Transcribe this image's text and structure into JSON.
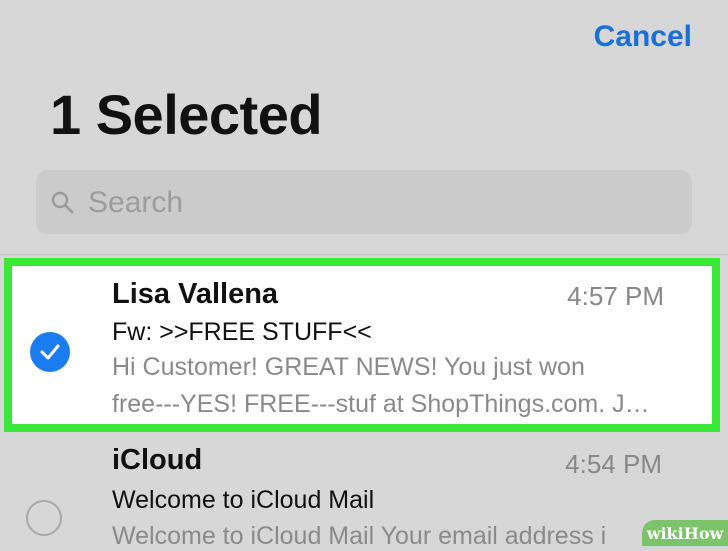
{
  "header": {
    "cancel_label": "Cancel",
    "title": "1 Selected"
  },
  "search": {
    "placeholder": "Search"
  },
  "messages": [
    {
      "sender": "Lisa Vallena",
      "time": "4:57 PM",
      "subject": "Fw: >>FREE STUFF<<",
      "preview_line1": "Hi Customer! GREAT NEWS! You just won",
      "preview_line2": "free---YES! FREE---stuf at ShopThings.com. J…",
      "selected": true
    },
    {
      "sender": "iCloud",
      "time": "4:54 PM",
      "subject": "Welcome to iCloud Mail",
      "preview_line1": "Welcome to iCloud Mail Your email address i",
      "selected": false
    }
  ],
  "watermark": "wikiHow",
  "colors": {
    "accent": "#1a6fd8",
    "highlight": "#3ae83a",
    "background": "#d7d7d7"
  },
  "icons": {
    "search": "search-icon",
    "check": "checkmark-icon",
    "radio": "empty-circle-icon"
  }
}
